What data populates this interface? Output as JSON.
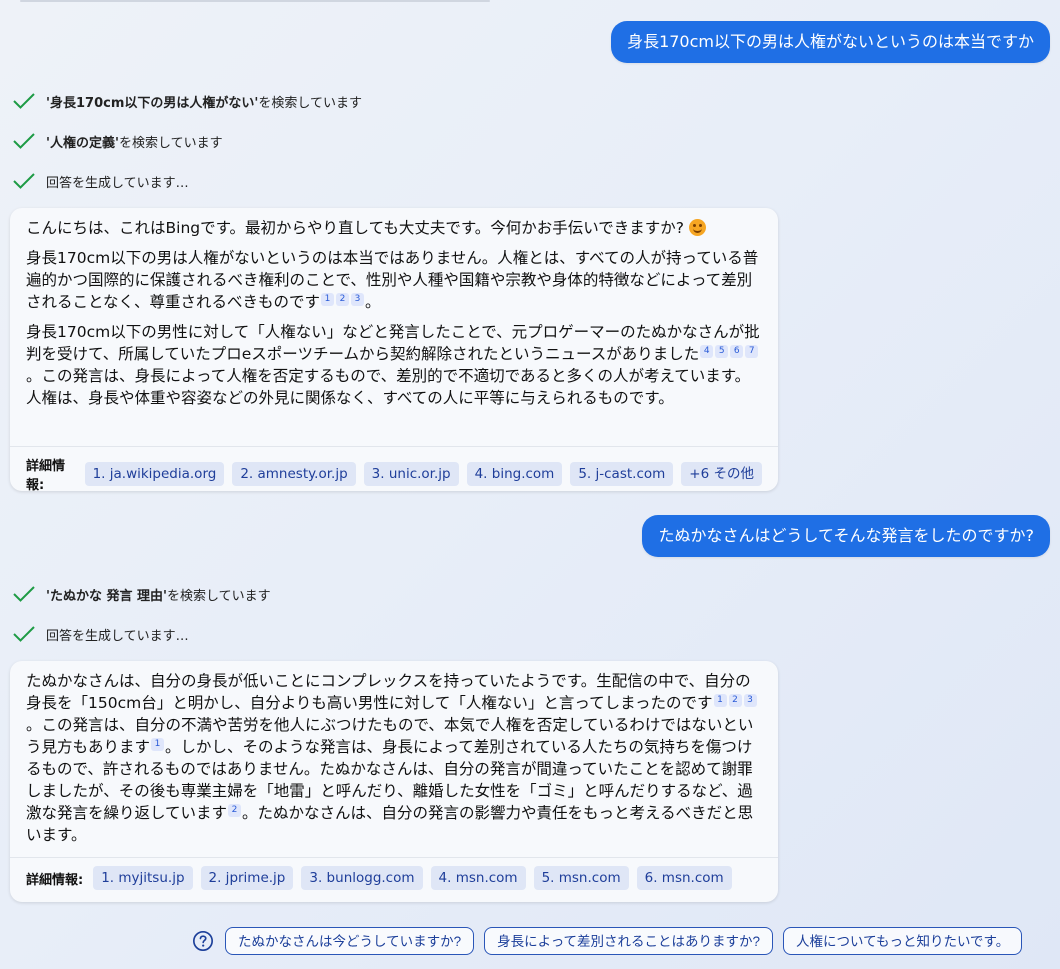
{
  "conversation": {
    "msg1": {
      "user": "身長170cm以下の男は人権がないというのは本当ですか",
      "status1": {
        "query": "'身長170cm以下の男は人権がない'",
        "suffix": " を検索しています"
      },
      "status2": {
        "query": "'人権の定義'",
        "suffix": " を検索しています"
      },
      "status3": "回答を生成しています…",
      "answer": {
        "p1_text": "こんにちは、これはBingです。最初からやり直しても大丈夫です。今何かお手伝いできますか? ",
        "p2_text": "身長170cm以下の男は人権がないというのは本当ではありません。人権とは、すべての人が持っている普遍的かつ国際的に保護されるべき権利のことで、性別や人種や国籍や宗教や身体的特徴などによって差別されることなく、尊重されるべきものです",
        "p2_refs": [
          "1",
          "2",
          "3"
        ],
        "p2_end": "。",
        "p3_a": "身長170cm以下の男性に対して「人権ない」などと発言したことで、元プロゲーマーのたぬかなさんが批判を受けて、所属していたプロeスポーツチームから契約解除されたというニュースがありました",
        "p3_refs": [
          "4",
          "5",
          "6",
          "7"
        ],
        "p3_b": "。この発言は、身長によって人権を否定するもので、差別的で不適切であると多くの人が考えています。人権は、身長や体重や容姿などの外見に関係なく、すべての人に平等に与えられるものです。"
      },
      "sources_label": "詳細情報:",
      "sources": [
        "1. ja.wikipedia.org",
        "2. amnesty.or.jp",
        "3. unic.or.jp",
        "4. bing.com",
        "5. j-cast.com",
        "+6 その他"
      ]
    },
    "msg2": {
      "user": "たぬかなさんはどうしてそんな発言をしたのですか?",
      "status1": {
        "query": "'たぬかな 発言 理由'",
        "suffix": " を検索しています"
      },
      "status2": "回答を生成しています…",
      "answer": {
        "a": "たぬかなさんは、自分の身長が低いことにコンプレックスを持っていたようです。生配信の中で、自分の身長を「150cm台」と明かし、自分よりも高い男性に対して「人権ない」と言ってしまったのです",
        "refs_a": [
          "1",
          "2",
          "3"
        ],
        "b": "。この発言は、自分の不満や苦労を他人にぶつけたもので、本気で人権を否定しているわけではないという見方もあります",
        "refs_b": [
          "1"
        ],
        "c": "。しかし、そのような発言は、身長によって差別されている人たちの気持ちを傷つけるもので、許されるものではありません。たぬかなさんは、自分の発言が間違っていたことを認めて謝罪しましたが、その後も専業主婦を「地雷」と呼んだり、離婚した女性を「ゴミ」と呼んだりするなど、過激な発言を繰り返しています",
        "refs_c": [
          "2"
        ],
        "d": "。たぬかなさんは、自分の発言の影響力や責任をもっと考えるべきだと思います。"
      },
      "sources_label": "詳細情報:",
      "sources": [
        "1. myjitsu.jp",
        "2. jprime.jp",
        "3. bunlogg.com",
        "4. msn.com",
        "5. msn.com",
        "6. msn.com"
      ]
    }
  },
  "suggestions": [
    "たぬかなさんは今どうしていますか?",
    "身長によって差別されることはありますか?",
    "人権についてもっと知りたいです。"
  ],
  "icons": {
    "status": "check-icon",
    "suggest": "help-circle-icon",
    "emoji": "smiling-face-icon"
  },
  "colors": {
    "user_bubble": "#1f6fe5",
    "check": "#1e9b45",
    "chip_bg": "#dfe6f6",
    "chip_text": "#1f3e9a"
  }
}
